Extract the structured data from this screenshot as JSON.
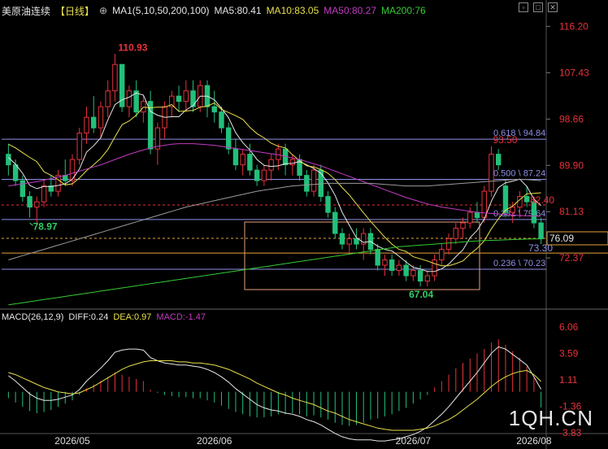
{
  "header": {
    "instrument": "美原油连续",
    "period": "【日线】",
    "ma_label": "MA1(5,10,50,200,100)",
    "ma5": "MA5:80.41",
    "ma10": "MA10:83.05",
    "ma50": "MA50:80.27",
    "ma200": "MA200:76"
  },
  "macd_header": {
    "label": "MACD(26,12,9)",
    "diff": "DIFF:0.24",
    "dea": "DEA:0.97",
    "macd": "MACD:-1.47"
  },
  "watermark": "1QH.CN",
  "colors": {
    "up": "#e8323c",
    "down": "#22c07a",
    "ma5": "#e6e6e6",
    "ma10": "#e8e04a",
    "ma50": "#c23cc2",
    "ma200": "#33cc33",
    "ma100": "#9a9a9a",
    "fib": "#8f8fe6"
  },
  "chart_data": [
    {
      "type": "candlestick",
      "y_axis_ticks": [
        "116.20",
        "107.43",
        "98.66",
        "89.90",
        "81.13",
        "72.37"
      ],
      "ylim": [
        63.0,
        117.5
      ],
      "x_ticks": [
        "2026/05",
        "2026/06",
        "2026/07",
        "2026/08"
      ],
      "annotations": {
        "high": "110.93",
        "low1": "78.97",
        "low2": "67.04",
        "peak2": "93.50",
        "level_824": "82.40",
        "tag_7330": "73.30",
        "last_price": "76.09"
      },
      "fib_levels": [
        {
          "label": "0.618 \\ 94.84",
          "value": 94.84
        },
        {
          "label": "0.500 \\ 87.24",
          "value": 87.24
        },
        {
          "label": "0.382 \\ 79.64",
          "value": 79.64
        },
        {
          "label": "0.236 \\ 70.23",
          "value": 70.23
        }
      ],
      "candles": [
        [
          92,
          94,
          88,
          90
        ],
        [
          90,
          91,
          86,
          87
        ],
        [
          87,
          88,
          83,
          84
        ],
        [
          84,
          85,
          80,
          82
        ],
        [
          82,
          84,
          79,
          83
        ],
        [
          83,
          87,
          82,
          86
        ],
        [
          86,
          88,
          84,
          85
        ],
        [
          85,
          89,
          84,
          88
        ],
        [
          88,
          91,
          86,
          87
        ],
        [
          87,
          92,
          86,
          91
        ],
        [
          91,
          97,
          90,
          96
        ],
        [
          96,
          101,
          94,
          99
        ],
        [
          99,
          103,
          96,
          97
        ],
        [
          97,
          102,
          95,
          101
        ],
        [
          101,
          106,
          99,
          104
        ],
        [
          104,
          111,
          102,
          109
        ],
        [
          109,
          109,
          100,
          101
        ],
        [
          101,
          105,
          99,
          104
        ],
        [
          104,
          106,
          99,
          100
        ],
        [
          100,
          103,
          98,
          102
        ],
        [
          102,
          104,
          92,
          93
        ],
        [
          93,
          98,
          90,
          97
        ],
        [
          97,
          102,
          95,
          101
        ],
        [
          101,
          104,
          99,
          103
        ],
        [
          103,
          105,
          100,
          102
        ],
        [
          102,
          106,
          100,
          104
        ],
        [
          104,
          106,
          100,
          101
        ],
        [
          101,
          106,
          100,
          105
        ],
        [
          105,
          106,
          99,
          101
        ],
        [
          101,
          104,
          98,
          100
        ],
        [
          100,
          101,
          96,
          97
        ],
        [
          97,
          98,
          92,
          93
        ],
        [
          93,
          95,
          89,
          90
        ],
        [
          90,
          93,
          88,
          92
        ],
        [
          92,
          94,
          88,
          89
        ],
        [
          89,
          90,
          86,
          87
        ],
        [
          87,
          90,
          86,
          89
        ],
        [
          89,
          92,
          87,
          91
        ],
        [
          91,
          94,
          89,
          93
        ],
        [
          93,
          94,
          88,
          90
        ],
        [
          90,
          92,
          88,
          91
        ],
        [
          91,
          92,
          87,
          88
        ],
        [
          88,
          89,
          84,
          85
        ],
        [
          85,
          90,
          84,
          89
        ],
        [
          89,
          90,
          83,
          84
        ],
        [
          84,
          85,
          80,
          81
        ],
        [
          81,
          82,
          76,
          77
        ],
        [
          77,
          78,
          74,
          75
        ],
        [
          75,
          77,
          73,
          76
        ],
        [
          76,
          78,
          74,
          75
        ],
        [
          75,
          78,
          72,
          77
        ],
        [
          77,
          78,
          73,
          74
        ],
        [
          74,
          75,
          70,
          71
        ],
        [
          71,
          73,
          69,
          72
        ],
        [
          72,
          73,
          69,
          70
        ],
        [
          70,
          72,
          69,
          71
        ],
        [
          71,
          72,
          68,
          69
        ],
        [
          69,
          71,
          68,
          70
        ],
        [
          70,
          71,
          67,
          68
        ],
        [
          68,
          70,
          67,
          69
        ],
        [
          69,
          73,
          68,
          72
        ],
        [
          72,
          75,
          71,
          74
        ],
        [
          74,
          77,
          73,
          76
        ],
        [
          76,
          79,
          75,
          78
        ],
        [
          78,
          80,
          76,
          79
        ],
        [
          79,
          82,
          78,
          81
        ],
        [
          81,
          83,
          79,
          80
        ],
        [
          80,
          86,
          79,
          85
        ],
        [
          85,
          93.5,
          84,
          92
        ],
        [
          92,
          93,
          89,
          90
        ],
        [
          86,
          87,
          80,
          81
        ],
        [
          81,
          83,
          79,
          82
        ],
        [
          82,
          85,
          80,
          84
        ],
        [
          84,
          86,
          82,
          83
        ],
        [
          83,
          84,
          78,
          79
        ],
        [
          79,
          80,
          75,
          76
        ]
      ],
      "series": [
        {
          "name": "MA5",
          "values": [
            91.4,
            90.1,
            88.4,
            86.1,
            85.5,
            85.9,
            85.9,
            86.1,
            86.4,
            87.3,
            89.2,
            92.4,
            93.6,
            95.1,
            98.5,
            101.4,
            102.3,
            102.8,
            103.6,
            103.2,
            100.1,
            99.4,
            99.0,
            99.1,
            99.1,
            100.4,
            101.2,
            103.0,
            103.0,
            102.3,
            100.7,
            98.9,
            96.1,
            94.2,
            92.8,
            91.0,
            89.9,
            89.7,
            89.8,
            90.2,
            90.3,
            90.6,
            90.0,
            89.3,
            88.4,
            86.6,
            84.2,
            81.0,
            78.6,
            76.2,
            75.3,
            75.5,
            74.6,
            74.0,
            73.7,
            72.7,
            71.6,
            70.6,
            70.3,
            69.8,
            69.8,
            70.3,
            71.2,
            72.6,
            73.9,
            76.2,
            77.6,
            79.7,
            83.1,
            85.7,
            86.6,
            86.9,
            87.3,
            85.9,
            83.5,
            82.3
          ]
        },
        {
          "name": "MA10",
          "values": [
            93.9,
            93.2,
            92.3,
            91.4,
            90.6,
            88.7,
            88.0,
            87.2,
            86.2,
            86.4,
            87.5,
            88.9,
            90.0,
            91.2,
            92.9,
            95.3,
            97.6,
            98.3,
            99.4,
            100.9,
            100.8,
            100.9,
            100.9,
            101.4,
            100.1,
            100.2,
            100.3,
            100.9,
            101.1,
            101.7,
            100.5,
            99.9,
            99.3,
            98.6,
            97.1,
            95.9,
            95.1,
            94.1,
            93.5,
            93.2,
            91.9,
            90.8,
            89.8,
            89.6,
            89.1,
            88.4,
            87.2,
            85.7,
            84.3,
            82.6,
            80.9,
            79.3,
            77.8,
            76.3,
            75.0,
            74.0,
            73.6,
            72.6,
            72.2,
            71.8,
            71.3,
            70.9,
            70.9,
            71.3,
            71.8,
            73.1,
            74.2,
            75.6,
            77.9,
            79.8,
            81.4,
            82.2,
            83.4,
            84.5,
            84.6,
            84.7
          ]
        },
        {
          "name": "MA50",
          "values": [
            86,
            86.2,
            86.4,
            86.6,
            86.8,
            87.1,
            87.4,
            87.7,
            88,
            88.4,
            88.8,
            89.2,
            89.6,
            90,
            90.5,
            91,
            91.5,
            92,
            92.4,
            92.8,
            93.2,
            93.5,
            93.7,
            93.9,
            94.0,
            94.0,
            94.0,
            93.9,
            93.8,
            93.7,
            93.5,
            93.3,
            93.1,
            92.9,
            92.7,
            92.5,
            92.3,
            92.1,
            91.9,
            91.6,
            91.3,
            91.0,
            90.6,
            90.2,
            89.8,
            89.3,
            88.8,
            88.3,
            87.8,
            87.3,
            86.8,
            86.3,
            85.8,
            85.3,
            84.8,
            84.3,
            83.8,
            83.4,
            83.0,
            82.6,
            82.3,
            82.0,
            81.8,
            81.6,
            81.4,
            81.2,
            81.0,
            80.9,
            80.8,
            80.7,
            80.6,
            80.5,
            80.4,
            80.35,
            80.3,
            80.27
          ]
        },
        {
          "name": "MA200",
          "values": [
            63.5,
            63.7,
            63.9,
            64.1,
            64.3,
            64.5,
            64.7,
            64.9,
            65.1,
            65.3,
            65.5,
            65.7,
            65.9,
            66.1,
            66.3,
            66.5,
            66.7,
            66.9,
            67.1,
            67.3,
            67.5,
            67.7,
            67.9,
            68.1,
            68.3,
            68.5,
            68.7,
            68.9,
            69.1,
            69.3,
            69.5,
            69.7,
            69.9,
            70.1,
            70.3,
            70.5,
            70.7,
            70.9,
            71.1,
            71.3,
            71.5,
            71.7,
            71.9,
            72.1,
            72.3,
            72.5,
            72.7,
            72.9,
            73.1,
            73.3,
            73.5,
            73.7,
            73.9,
            74.1,
            74.3,
            74.5,
            74.6,
            74.7,
            74.8,
            74.9,
            75.0,
            75.1,
            75.2,
            75.3,
            75.4,
            75.5,
            75.6,
            75.65,
            75.7,
            75.75,
            75.8,
            75.85,
            75.9,
            75.95,
            75.98,
            76.0
          ]
        },
        {
          "name": "MA100",
          "values": [
            72,
            72.4,
            72.8,
            73.2,
            73.6,
            74,
            74.4,
            74.8,
            75.2,
            75.6,
            76,
            76.4,
            76.8,
            77.2,
            77.6,
            78,
            78.4,
            78.8,
            79.2,
            79.6,
            80,
            80.4,
            80.8,
            81.2,
            81.6,
            82,
            82.3,
            82.6,
            82.9,
            83.2,
            83.5,
            83.8,
            84.1,
            84.4,
            84.7,
            85,
            85.2,
            85.4,
            85.6,
            85.8,
            86,
            86.1,
            86.2,
            86.3,
            86.4,
            86.5,
            86.5,
            86.5,
            86.5,
            86.5,
            86.5,
            86.5,
            86.4,
            86.3,
            86.2,
            86.1,
            86.0,
            86.0,
            86.0,
            86.0,
            86.1,
            86.2,
            86.3,
            86.4,
            86.5,
            86.6,
            86.7,
            86.8,
            86.9,
            87.0,
            87.1,
            87.2,
            87.2,
            87.2,
            87.1,
            87.0
          ]
        }
      ]
    },
    {
      "type": "bar",
      "title": "MACD(26,12,9)",
      "y_axis_ticks": [
        "6.06",
        "3.59",
        "1.11",
        "-1.36",
        "-3.83"
      ],
      "ylim": [
        -3.83,
        6.06
      ],
      "macd": [
        -0.6,
        -1.0,
        -1.4,
        -1.8,
        -2.0,
        -1.9,
        -1.7,
        -1.4,
        -1.1,
        -0.8,
        -0.3,
        0.3,
        0.7,
        1.0,
        1.4,
        1.8,
        1.6,
        1.4,
        1.2,
        1.0,
        0.2,
        -0.1,
        -0.3,
        -0.4,
        -0.5,
        -0.5,
        -0.6,
        -0.6,
        -0.8,
        -1.0,
        -1.3,
        -1.6,
        -1.9,
        -2.1,
        -2.3,
        -2.4,
        -2.4,
        -2.3,
        -2.1,
        -2.1,
        -2.0,
        -2.1,
        -2.3,
        -2.2,
        -2.4,
        -2.6,
        -2.9,
        -3.1,
        -3.2,
        -3.1,
        -2.9,
        -2.6,
        -2.5,
        -2.3,
        -2.1,
        -1.8,
        -1.5,
        -1.1,
        -0.7,
        -0.3,
        0.4,
        1.0,
        1.6,
        2.2,
        2.7,
        3.1,
        3.6,
        4.0,
        4.6,
        4.9,
        4.4,
        3.8,
        3.2,
        2.4,
        1.3,
        -1.47
      ],
      "diff": [
        1.5,
        1.0,
        0.4,
        -0.2,
        -0.6,
        -0.8,
        -0.8,
        -0.7,
        -0.5,
        -0.3,
        0.2,
        1.0,
        1.6,
        2.2,
        2.9,
        3.7,
        3.9,
        4.0,
        4.0,
        3.9,
        3.2,
        2.9,
        2.7,
        2.6,
        2.5,
        2.5,
        2.4,
        2.3,
        2.1,
        1.8,
        1.4,
        0.9,
        0.3,
        -0.2,
        -0.7,
        -1.2,
        -1.5,
        -1.7,
        -1.8,
        -2.0,
        -2.1,
        -2.3,
        -2.6,
        -2.8,
        -3.1,
        -3.5,
        -3.9,
        -4.2,
        -4.4,
        -4.5,
        -4.5,
        -4.5,
        -4.6,
        -4.6,
        -4.5,
        -4.4,
        -4.2,
        -4.0,
        -3.7,
        -3.3,
        -2.7,
        -2.1,
        -1.4,
        -0.6,
        0.2,
        1.0,
        1.8,
        2.7,
        3.6,
        4.2,
        4.0,
        3.5,
        3.0,
        2.5,
        1.4,
        0.24
      ],
      "dea": [
        1.8,
        1.6,
        1.3,
        1.0,
        0.7,
        0.4,
        0.2,
        0.0,
        -0.1,
        -0.2,
        -0.1,
        0.2,
        0.5,
        0.9,
        1.3,
        1.7,
        2.1,
        2.4,
        2.6,
        2.8,
        2.9,
        2.9,
        2.9,
        2.9,
        2.8,
        2.8,
        2.7,
        2.7,
        2.6,
        2.5,
        2.3,
        2.1,
        1.8,
        1.5,
        1.2,
        0.8,
        0.5,
        0.2,
        -0.1,
        -0.3,
        -0.6,
        -0.8,
        -1.0,
        -1.2,
        -1.5,
        -1.8,
        -2.0,
        -2.3,
        -2.6,
        -2.8,
        -3.0,
        -3.2,
        -3.4,
        -3.5,
        -3.6,
        -3.6,
        -3.6,
        -3.6,
        -3.5,
        -3.4,
        -3.2,
        -2.9,
        -2.6,
        -2.2,
        -1.7,
        -1.2,
        -0.7,
        -0.1,
        0.5,
        1.0,
        1.4,
        1.7,
        1.9,
        2.0,
        1.6,
        0.97
      ]
    }
  ]
}
